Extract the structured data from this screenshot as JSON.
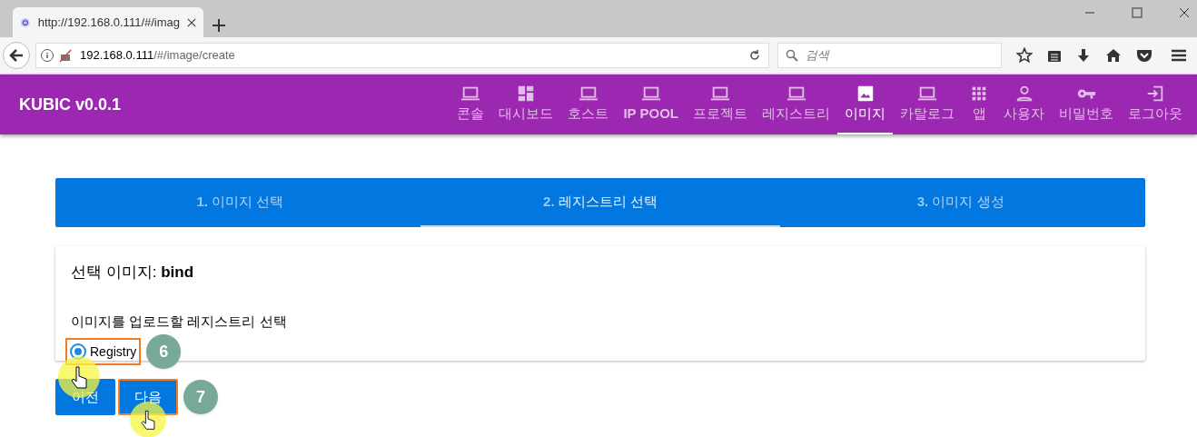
{
  "browser": {
    "tab_title": "http://192.168.0.111/#/imag",
    "url_host": "192.168.0.111",
    "url_path": "/#/image/create",
    "search_placeholder": "검색"
  },
  "app": {
    "title": "KUBIC v0.0.1"
  },
  "nav": [
    {
      "label": "콘솔",
      "kind": "laptop",
      "selected": false
    },
    {
      "label": "대시보드",
      "kind": "dashboard",
      "selected": false
    },
    {
      "label": "호스트",
      "kind": "laptop",
      "selected": false
    },
    {
      "label": "IP POOL",
      "kind": "laptop",
      "selected": false
    },
    {
      "label": "프로젝트",
      "kind": "laptop",
      "selected": false
    },
    {
      "label": "레지스트리",
      "kind": "laptop",
      "selected": false
    },
    {
      "label": "이미지",
      "kind": "image",
      "selected": true
    },
    {
      "label": "카탈로그",
      "kind": "laptop",
      "selected": false
    },
    {
      "label": "앱",
      "kind": "apps",
      "selected": false
    },
    {
      "label": "사용자",
      "kind": "person",
      "selected": false
    },
    {
      "label": "비밀번호",
      "kind": "key",
      "selected": false
    },
    {
      "label": "로그아웃",
      "kind": "logout",
      "selected": false
    }
  ],
  "steps": [
    {
      "number": "1.",
      "label": "이미지 선택",
      "selected": false
    },
    {
      "number": "2.",
      "label": "레지스트리 선택",
      "selected": true
    },
    {
      "number": "3.",
      "label": "이미지 생성",
      "selected": false
    }
  ],
  "card": {
    "selected_label": "선택 이미지:",
    "selected_value": "bind",
    "prompt": "이미지를 업로드할 레지스트리 선택",
    "options": [
      {
        "label": "Registry",
        "selected": true
      }
    ]
  },
  "buttons": [
    {
      "label": "이전"
    },
    {
      "label": "다음"
    }
  ],
  "annotations": [
    {
      "number": "6"
    },
    {
      "number": "7"
    }
  ]
}
